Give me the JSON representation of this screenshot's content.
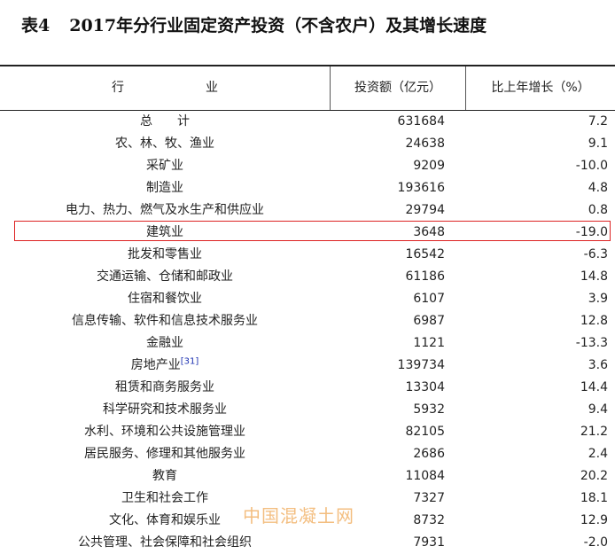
{
  "title": {
    "table_no": "表4",
    "text": "2017年分行业固定资产投资（不含农户）及其增长速度"
  },
  "header": {
    "industry": [
      "行",
      "业"
    ],
    "amount": "投资额（亿元）",
    "growth": "比上年增长（%）"
  },
  "rows": [
    {
      "name": "总　　计",
      "amount": "631684",
      "growth": "7.2"
    },
    {
      "name": "农、林、牧、渔业",
      "amount": "24638",
      "growth": "9.1"
    },
    {
      "name": "采矿业",
      "amount": "9209",
      "growth": "-10.0"
    },
    {
      "name": "制造业",
      "amount": "193616",
      "growth": "4.8"
    },
    {
      "name": "电力、热力、燃气及水生产和供应业",
      "amount": "29794",
      "growth": "0.8"
    },
    {
      "name": "建筑业",
      "amount": "3648",
      "growth": "-19.0"
    },
    {
      "name": "批发和零售业",
      "amount": "16542",
      "growth": "-6.3"
    },
    {
      "name": "交通运输、仓储和邮政业",
      "amount": "61186",
      "growth": "14.8"
    },
    {
      "name": "住宿和餐饮业",
      "amount": "6107",
      "growth": "3.9"
    },
    {
      "name": "信息传输、软件和信息技术服务业",
      "amount": "6987",
      "growth": "12.8"
    },
    {
      "name": "金融业",
      "amount": "1121",
      "growth": "-13.3"
    },
    {
      "name": "房地产业",
      "footnote": "[31]",
      "amount": "139734",
      "growth": "3.6"
    },
    {
      "name": "租赁和商务服务业",
      "amount": "13304",
      "growth": "14.4"
    },
    {
      "name": "科学研究和技术服务业",
      "amount": "5932",
      "growth": "9.4"
    },
    {
      "name": "水利、环境和公共设施管理业",
      "amount": "82105",
      "growth": "21.2"
    },
    {
      "name": "居民服务、修理和其他服务业",
      "amount": "2686",
      "growth": "2.4"
    },
    {
      "name": "教育",
      "amount": "11084",
      "growth": "20.2"
    },
    {
      "name": "卫生和社会工作",
      "amount": "7327",
      "growth": "18.1"
    },
    {
      "name": "文化、体育和娱乐业",
      "amount": "8732",
      "growth": "12.9"
    },
    {
      "name": "公共管理、社会保障和社会组织",
      "amount": "7931",
      "growth": "-2.0"
    }
  ],
  "watermark": "中国混凝土网",
  "colors": {
    "highlight_border": "#dd2222",
    "footnote_link": "#1a2fb0",
    "watermark": "#f2b36a"
  }
}
